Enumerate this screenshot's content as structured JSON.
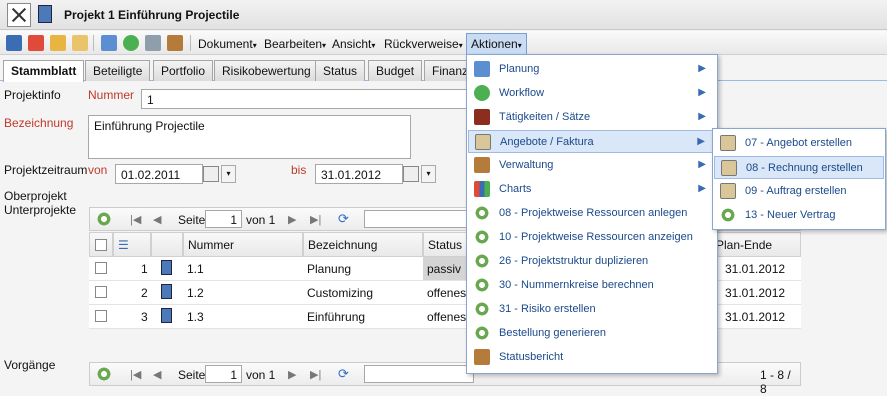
{
  "window": {
    "title": "Projekt 1 Einführung Projectile"
  },
  "toolbar": {
    "menus": [
      "Dokument",
      "Bearbeiten",
      "Ansicht",
      "Rückverweise",
      "Aktionen"
    ],
    "arrow": "▾"
  },
  "tabs": [
    "Stammblatt",
    "Beteiligte",
    "Portfolio",
    "Risikobewertung",
    "Status",
    "Budget",
    "Finanz"
  ],
  "form": {
    "projektinfo_label": "Projektinfo",
    "nummer_label": "Nummer",
    "nummer_value": "1",
    "bezeichnung_label": "Bezeichnung",
    "bezeichnung_value": "Einführung Projectile",
    "zeitraum_label": "Projektzeitraum",
    "von_label": "von",
    "von_value": "01.02.2011",
    "bis_label": "bis",
    "bis_value": "31.01.2012",
    "oberprojekt_label": "Oberprojekt",
    "unterprojekte_label": "Unterprojekte",
    "vorgaenge_label": "Vorgänge"
  },
  "pager": {
    "seite_label": "Seite",
    "page": "1",
    "von_label": "von 1",
    "count": "1 - 8 / 8"
  },
  "grid": {
    "columns": [
      "Nummer",
      "Bezeichnung",
      "Status",
      "Plan-Ende"
    ],
    "rows": [
      {
        "idx": "1",
        "nummer": "1.1",
        "bezeichnung": "Planung",
        "status": "passiv",
        "ende": "31.01.2012"
      },
      {
        "idx": "2",
        "nummer": "1.2",
        "bezeichnung": "Customizing",
        "status": "offenes",
        "ende": "31.01.2012"
      },
      {
        "idx": "3",
        "nummer": "1.3",
        "bezeichnung": "Einführung",
        "status": "offenes",
        "ende": "31.01.2012"
      }
    ]
  },
  "aktionen_menu": [
    {
      "label": "Planung",
      "icon": "planning-icon",
      "submenu": true
    },
    {
      "label": "Workflow",
      "icon": "workflow-icon",
      "submenu": true
    },
    {
      "label": "Tätigkeiten / Sätze",
      "icon": "hammer-icon",
      "submenu": true
    },
    {
      "label": "Angebote / Faktura",
      "icon": "invoice-icon",
      "submenu": true
    },
    {
      "label": "Verwaltung",
      "icon": "edit-icon",
      "submenu": true
    },
    {
      "label": "Charts",
      "icon": "chart-icon",
      "submenu": true
    },
    {
      "label": "08 - Projektweise Ressourcen anlegen",
      "icon": "gear-icon",
      "submenu": false
    },
    {
      "label": "10 - Projektweise Ressourcen anzeigen",
      "icon": "gear-icon",
      "submenu": false
    },
    {
      "label": "26 - Projektstruktur duplizieren",
      "icon": "gear-icon",
      "submenu": false
    },
    {
      "label": "30 - Nummernkreise berechnen",
      "icon": "gear-icon",
      "submenu": false
    },
    {
      "label": "31 - Risiko erstellen",
      "icon": "gear-icon",
      "submenu": false
    },
    {
      "label": "Bestellung generieren",
      "icon": "gear-icon",
      "submenu": false
    },
    {
      "label": "Statusbericht",
      "icon": "report-icon",
      "submenu": false
    }
  ],
  "angebote_submenu": [
    {
      "label": "07 - Angebot erstellen",
      "icon": "invoice-icon"
    },
    {
      "label": "08 - Rechnung erstellen",
      "icon": "invoice-icon"
    },
    {
      "label": "09 - Auftrag erstellen",
      "icon": "invoice-icon"
    },
    {
      "label": "13 - Neuer Vertrag",
      "icon": "gear-icon"
    }
  ],
  "submenu_arrow": "▶"
}
